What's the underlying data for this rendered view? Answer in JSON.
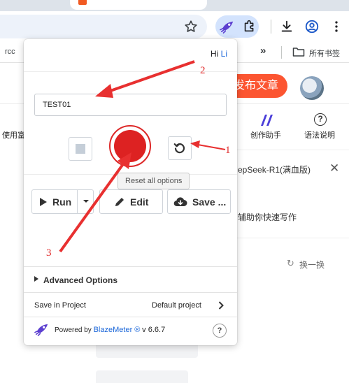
{
  "browser": {
    "bookmarks": {
      "item1": "rcc",
      "overflow": "»",
      "folder_label": "所有书签"
    }
  },
  "page": {
    "publish_button": "发布文章",
    "left_text": "使用富",
    "ai_assistant": "创作助手",
    "syntax_help": "语法说明",
    "model_text": "epSeek-R1(满血版)",
    "close": "✕",
    "assist_text": "辅助你快速写作",
    "refresh_label": "换一换"
  },
  "popup": {
    "greeting": "Hi",
    "user_name": "Li",
    "test_name": "TEST01",
    "tooltip": "Reset all options",
    "run_label": "Run",
    "edit_label": "Edit",
    "save_label": "Save ...",
    "advanced_options": "Advanced Options",
    "save_in_project": "Save in Project",
    "default_project": "Default project",
    "footer_powered": "Powered by",
    "footer_brand": "BlazeMeter ®",
    "footer_version": "v 6.6.7",
    "help": "?"
  },
  "annotations": {
    "label_1": "1",
    "label_2": "2",
    "label_3": "3"
  },
  "colors": {
    "record": "#dd2222",
    "annotation": "#e02a2a",
    "brand_blue": "#1a66d9",
    "publish": "#fc5531"
  }
}
